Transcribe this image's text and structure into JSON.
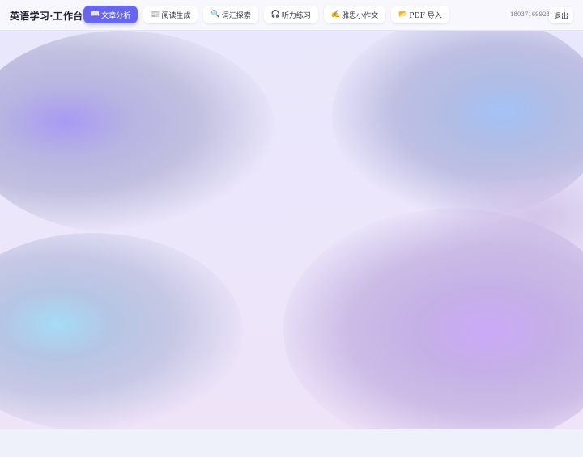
{
  "app": {
    "title": "英语学习·工作台"
  },
  "nav": {
    "tabs": [
      {
        "icon": "📖",
        "label": "文章分析",
        "active": true
      },
      {
        "icon": "📰",
        "label": "阅读生成",
        "active": false
      },
      {
        "icon": "🔍",
        "label": "词汇探索",
        "active": false
      },
      {
        "icon": "🎧",
        "label": "听力练习",
        "active": false
      },
      {
        "icon": "✍️",
        "label": "雅思小作文",
        "active": false
      },
      {
        "icon": "📂",
        "label": "PDF 导入",
        "active": false
      }
    ]
  },
  "user": {
    "phone": "18037169928",
    "logout_label": "退出"
  },
  "colors": {
    "accent": "#6666ee"
  }
}
